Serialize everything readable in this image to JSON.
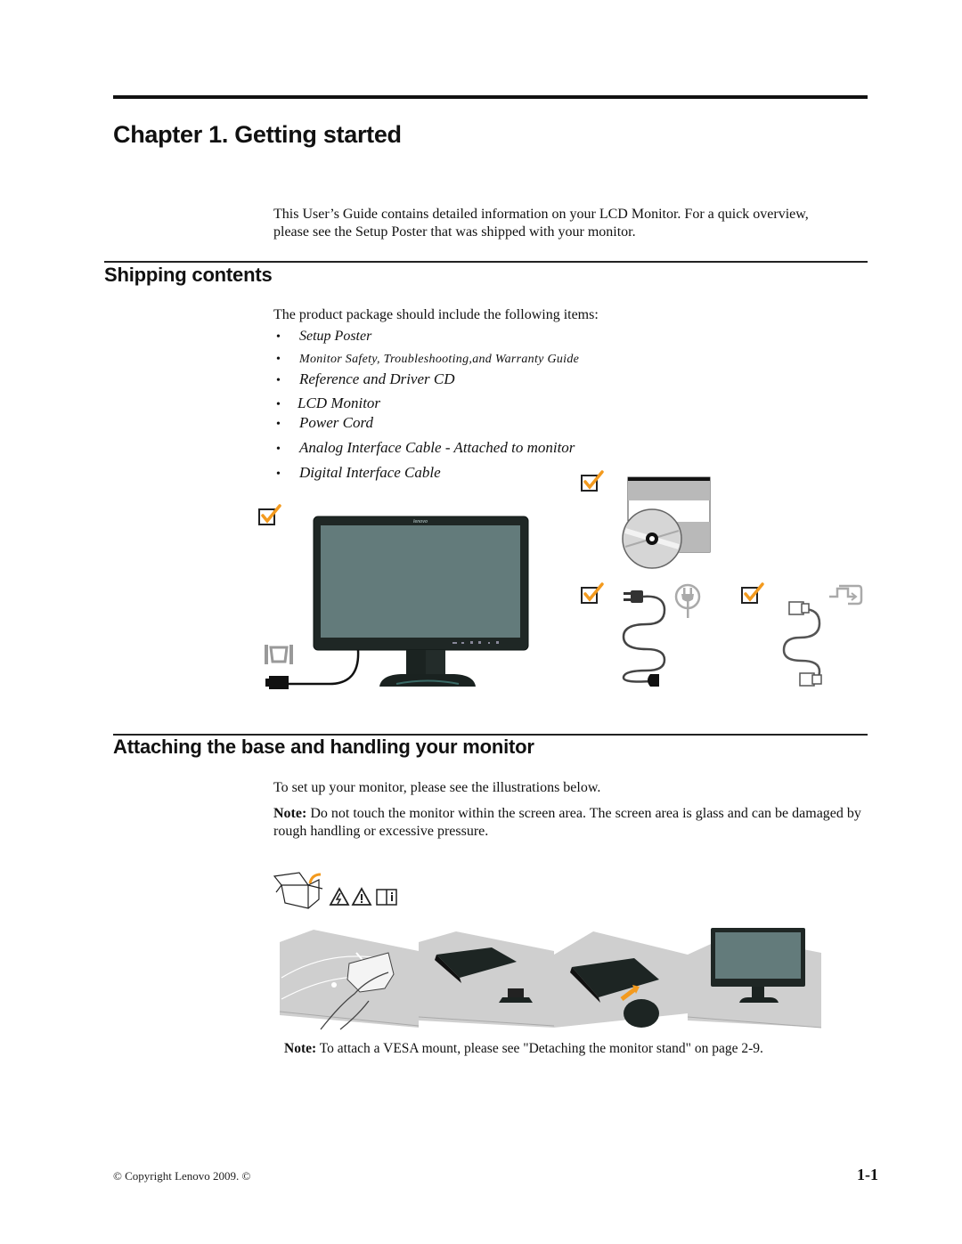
{
  "chapter": {
    "title": "Chapter 1. Getting started",
    "intro": "This User’s Guide contains detailed information on your LCD Monitor. For a quick overview, please see the Setup Poster that was shipped with your monitor."
  },
  "shipping": {
    "heading": "Shipping contents",
    "lead": "The product package should include the following items:",
    "items": [
      "Setup Poster",
      "Monitor Safety, Troubleshooting,and Warranty Guide",
      "Reference and Driver CD",
      "LCD Monitor",
      "Power Cord",
      "Analog Interface Cable - Attached to monitor",
      "Digital Interface Cable"
    ],
    "illustration": {
      "monitor_brand": "lenovo",
      "icons": [
        "checkbox-check-icon",
        "vga-port-icon",
        "cd-icon",
        "power-plug-icon",
        "dvi-port-icon"
      ],
      "accent_color": "#f39a1e",
      "screen_color": "#637b7b"
    }
  },
  "attaching": {
    "heading": "Attaching the base and handling your monitor",
    "lead": "To set up your monitor, please see the illustrations below.",
    "note_label": "Note:",
    "note_text": "Do not touch the monitor within the screen area. The screen area is glass and can be damaged by rough handling or excessive pressure.",
    "warning_icons": [
      "open-box-icon",
      "electric-hazard-icon",
      "caution-icon",
      "info-manual-icon"
    ],
    "steps": [
      "clean-surface",
      "place-monitor-facedown",
      "attach-base",
      "stand-monitor-upright"
    ],
    "vesa_note_label": "Note:",
    "vesa_note_text": "To attach a VESA mount, please see \"Detaching the monitor stand\" on page 2-9."
  },
  "footer": {
    "copyright": "© Copyright Lenovo 2009. ©",
    "page_number": "1-1"
  }
}
